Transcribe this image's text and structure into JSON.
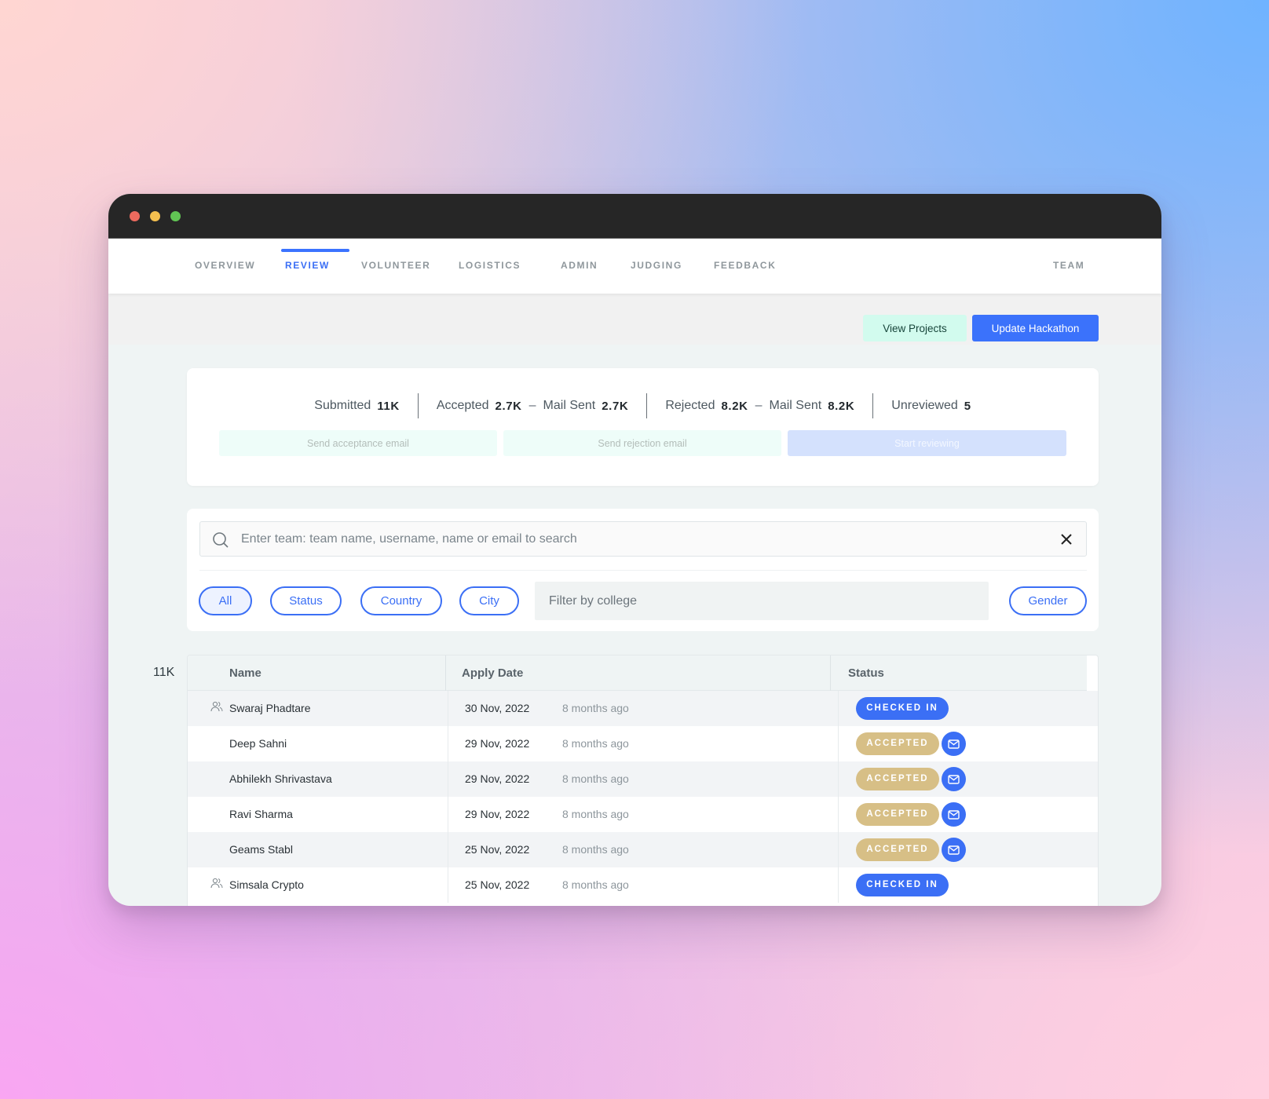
{
  "window": {
    "traffic_lights": [
      "close",
      "minimize",
      "maximize"
    ]
  },
  "nav": {
    "items": [
      {
        "label": "OVERVIEW",
        "active": false
      },
      {
        "label": "REVIEW",
        "active": true
      },
      {
        "label": "VOLUNTEER",
        "active": false
      },
      {
        "label": "LOGISTICS",
        "active": false
      },
      {
        "label": "ADMIN",
        "active": false
      },
      {
        "label": "JUDGING",
        "active": false
      },
      {
        "label": "FEEDBACK",
        "active": false
      }
    ],
    "right_item": "TEAM",
    "accent_color": "#3b6ff5"
  },
  "actions": {
    "view_projects": "View Projects",
    "update_hackathon": "Update Hackathon"
  },
  "stats": {
    "submitted_label": "Submitted",
    "submitted_value": "11K",
    "accepted_label": "Accepted",
    "accepted_value": "2.7K",
    "accepted_mail_label": "Mail Sent",
    "accepted_mail_value": "2.7K",
    "rejected_label": "Rejected",
    "rejected_value": "8.2K",
    "rejected_mail_label": "Mail Sent",
    "rejected_mail_value": "8.2K",
    "unreviewed_label": "Unreviewed",
    "unreviewed_value": "5",
    "dash": "–",
    "buttons": {
      "send_acceptance": "Send acceptance email",
      "send_rejection": "Send rejection email",
      "start_reviewing": "Start reviewing"
    }
  },
  "filters": {
    "search_placeholder": "Enter team: team name, username, name or email to search",
    "search_value": "",
    "pills": [
      "All",
      "Status",
      "Country",
      "City"
    ],
    "active_pill": "All",
    "college_placeholder": "Filter by college",
    "gender_label": "Gender"
  },
  "table": {
    "total": "11K",
    "columns": [
      "Name",
      "Apply Date",
      "Status"
    ],
    "rows": [
      {
        "name": "Swaraj Phadtare",
        "team": true,
        "date": "30 Nov, 2022",
        "ago": "8 months ago",
        "status": "CHECKED IN",
        "mail": false
      },
      {
        "name": "Deep Sahni",
        "team": false,
        "date": "29 Nov, 2022",
        "ago": "8 months ago",
        "status": "ACCEPTED",
        "mail": true
      },
      {
        "name": "Abhilekh Shrivastava",
        "team": false,
        "date": "29 Nov, 2022",
        "ago": "8 months ago",
        "status": "ACCEPTED",
        "mail": true
      },
      {
        "name": "Ravi Sharma",
        "team": false,
        "date": "29 Nov, 2022",
        "ago": "8 months ago",
        "status": "ACCEPTED",
        "mail": true
      },
      {
        "name": "Geams Stabl",
        "team": false,
        "date": "25 Nov, 2022",
        "ago": "8 months ago",
        "status": "ACCEPTED",
        "mail": true
      },
      {
        "name": "Simsala Crypto",
        "team": true,
        "date": "25 Nov, 2022",
        "ago": "8 months ago",
        "status": "CHECKED IN",
        "mail": false
      }
    ],
    "status_colors": {
      "CHECKED IN": "#3b6ff5",
      "ACCEPTED": "#d7bf86"
    }
  }
}
